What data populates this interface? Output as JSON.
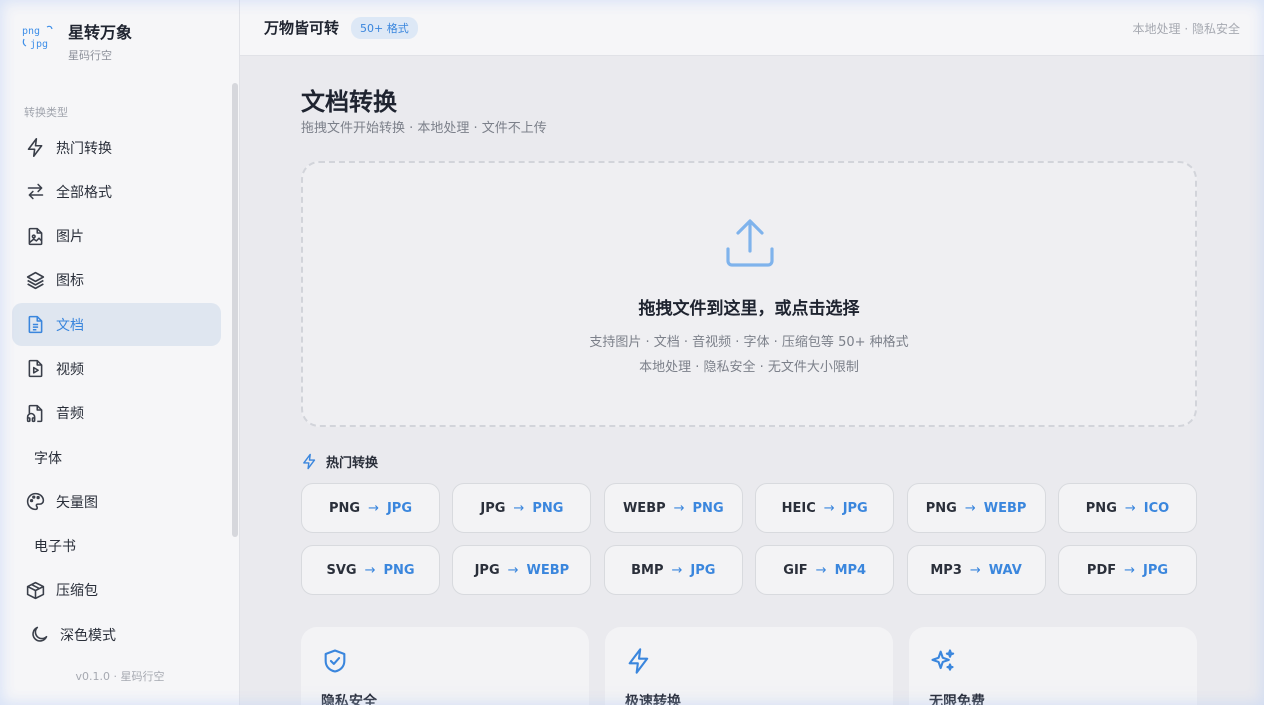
{
  "brand": {
    "logo_top": "png",
    "logo_bottom": "jpg",
    "title": "星转万象",
    "subtitle": "星码行空"
  },
  "sidebar": {
    "section_label": "转换类型",
    "items": [
      {
        "label": "热门转换",
        "icon": "lightning-icon",
        "active": false
      },
      {
        "label": "全部格式",
        "icon": "swap-arrows-icon",
        "active": false
      },
      {
        "label": "图片",
        "icon": "image-file-icon",
        "active": false
      },
      {
        "label": "图标",
        "icon": "layers-icon",
        "active": false
      },
      {
        "label": "文档",
        "icon": "document-icon",
        "active": true
      },
      {
        "label": "视频",
        "icon": "video-file-icon",
        "active": false
      },
      {
        "label": "音频",
        "icon": "audio-file-icon",
        "active": false
      },
      {
        "label": "字体",
        "icon": "",
        "active": false
      },
      {
        "label": "矢量图",
        "icon": "palette-icon",
        "active": false
      },
      {
        "label": "电子书",
        "icon": "",
        "active": false
      },
      {
        "label": "压缩包",
        "icon": "package-icon",
        "active": false
      }
    ],
    "dark_mode_label": "深色模式",
    "version": "v0.1.0 · 星码行空"
  },
  "topbar": {
    "title": "万物皆可转",
    "badge": "50+ 格式",
    "right": "本地处理 · 隐私安全"
  },
  "main": {
    "title": "文档转换",
    "subtitle": "拖拽文件开始转换 · 本地处理 · 文件不上传",
    "dropzone": {
      "title": "拖拽文件到这里，或点击选择",
      "line1": "支持图片 · 文档 · 音视频 · 字体 · 压缩包等 50+ 种格式",
      "line2": "本地处理 · 隐私安全 · 无文件大小限制"
    },
    "hot_label": "热门转换",
    "conversions": [
      {
        "from": "PNG",
        "to": "JPG"
      },
      {
        "from": "JPG",
        "to": "PNG"
      },
      {
        "from": "WEBP",
        "to": "PNG"
      },
      {
        "from": "HEIC",
        "to": "JPG"
      },
      {
        "from": "PNG",
        "to": "WEBP"
      },
      {
        "from": "PNG",
        "to": "ICO"
      },
      {
        "from": "SVG",
        "to": "PNG"
      },
      {
        "from": "JPG",
        "to": "WEBP"
      },
      {
        "from": "BMP",
        "to": "JPG"
      },
      {
        "from": "GIF",
        "to": "MP4"
      },
      {
        "from": "MP3",
        "to": "WAV"
      },
      {
        "from": "PDF",
        "to": "JPG"
      }
    ],
    "arrow_glyph": "→",
    "features": [
      {
        "title": "隐私安全",
        "icon": "shield-check-icon"
      },
      {
        "title": "极速转换",
        "icon": "lightning-icon"
      },
      {
        "title": "无限免费",
        "icon": "sparkles-icon"
      }
    ]
  },
  "colors": {
    "accent": "#3a86dd",
    "active_bg": "#dfe6f0",
    "background": "#eaeaee"
  }
}
